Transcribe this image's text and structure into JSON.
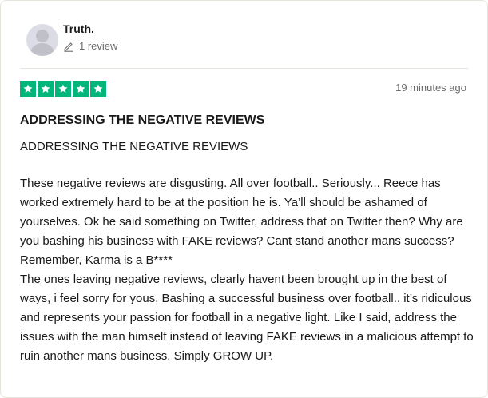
{
  "reviewer": {
    "name": "Truth.",
    "review_count": "1 review"
  },
  "review": {
    "rating": 5,
    "rating_max": 5,
    "star_color": "#00b67a",
    "date": "19 minutes ago",
    "title": "ADDRESSING THE NEGATIVE REVIEWS",
    "subtitle": "ADDRESSING THE NEGATIVE REVIEWS",
    "paragraph_1": "These negative reviews are disgusting. All over football.. Seriously... Reece has worked extremely hard to be at the position he is. Ya’ll should be ashamed of yourselves. Ok he said something on Twitter, address that on Twitter then? Why are you bashing his business with FAKE reviews? Cant stand another mans success? Remember, Karma is a B****",
    "paragraph_2": "The ones leaving negative reviews, clearly havent been brought up in the best of ways, i feel sorry for yous. Bashing a successful business over football.. it’s ridiculous and represents your passion for football in a negative light. Like I said, address the issues with the man himself instead of leaving FAKE reviews in a malicious attempt to ruin another mans business. Simply GROW UP."
  },
  "icons": {
    "avatar": "avatar-placeholder-icon",
    "review_count": "pencil-icon",
    "star": "star-icon"
  }
}
